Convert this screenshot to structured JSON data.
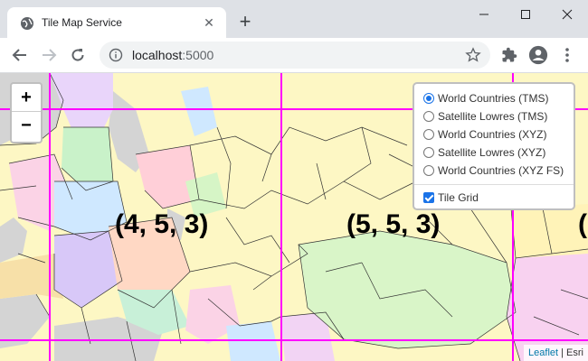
{
  "tab": {
    "title": "Tile Map Service",
    "favicon": "globe-icon",
    "close_glyph": "✕"
  },
  "new_tab_glyph": "+",
  "window_controls": [
    "minimize-icon",
    "maximize-icon",
    "close-icon"
  ],
  "address": {
    "host": "localhost",
    "port": ":5000"
  },
  "toolbar_icons": [
    "extensions-icon",
    "profile-icon",
    "menu-icon"
  ],
  "zoom": {
    "in_label": "+",
    "out_label": "−"
  },
  "tile_labels": [
    "(4, 5, 3)",
    "(5, 5, 3)",
    "("
  ],
  "layers": {
    "base": [
      {
        "label": "World Countries (TMS)",
        "selected": true
      },
      {
        "label": "Satellite Lowres (TMS)",
        "selected": false
      },
      {
        "label": "World Countries (XYZ)",
        "selected": false
      },
      {
        "label": "Satellite Lowres (XYZ)",
        "selected": false
      },
      {
        "label": "World Countries (XYZ FS)",
        "selected": false
      }
    ],
    "overlay": {
      "label": "Tile Grid",
      "checked": true
    }
  },
  "attribution": {
    "leaflet": "Leaflet",
    "separator": " | ",
    "provider": "Esri"
  },
  "colors": {
    "grid": "#ff00ff",
    "land": "#fdf7c4",
    "water": "#d4d4d4",
    "accent": "#1a73e8"
  }
}
